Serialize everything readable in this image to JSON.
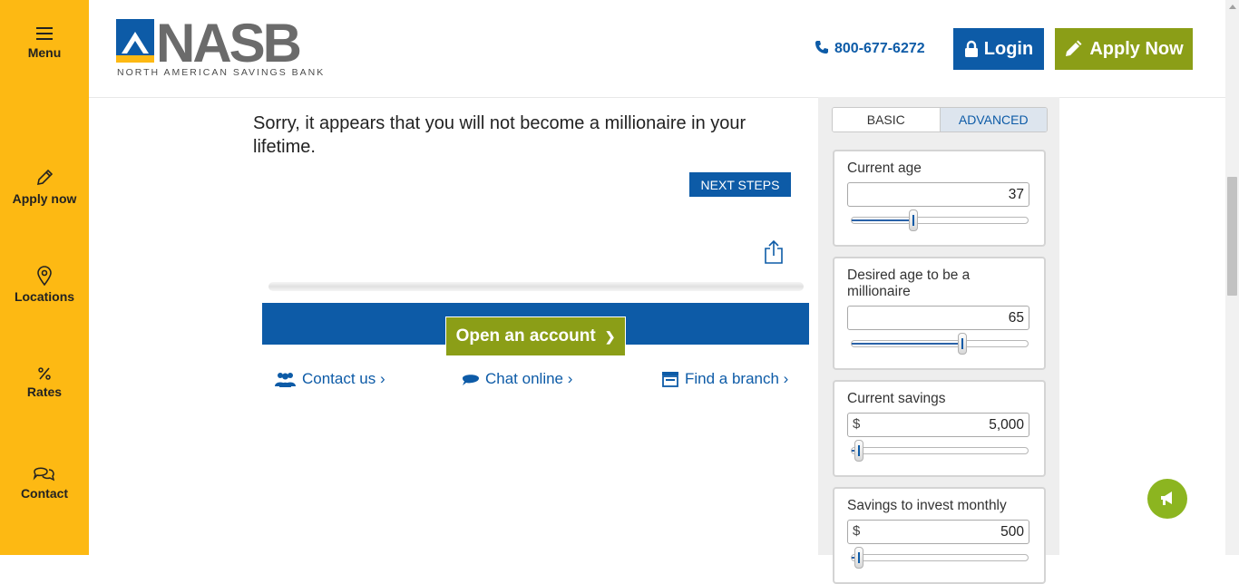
{
  "sidebar": {
    "items": [
      {
        "label": "Menu",
        "icon": "hamburger-icon"
      },
      {
        "label": "Apply now",
        "icon": "pencil-icon"
      },
      {
        "label": "Locations",
        "icon": "map-pin-icon"
      },
      {
        "label": "Rates",
        "icon": "percent-icon"
      },
      {
        "label": "Contact",
        "icon": "chat-bubbles-icon"
      }
    ]
  },
  "header": {
    "logo_text": "NASB",
    "logo_subtitle": "NORTH AMERICAN SAVINGS BANK",
    "phone": "800-677-6272",
    "login_label": "Login",
    "apply_label": "Apply Now"
  },
  "main": {
    "result_message": "Sorry, it appears that you will not become a millionaire in your lifetime.",
    "next_steps_label": "NEXT STEPS",
    "open_account_label": "Open an account",
    "open_account_chevron": "❯",
    "links": {
      "contact": "Contact us ›",
      "chat": "Chat online ›",
      "branch": "Find a branch ›"
    }
  },
  "calculator": {
    "tabs": {
      "basic": "BASIC",
      "advanced": "ADVANCED"
    },
    "fields": [
      {
        "label": "Current age",
        "value": "37",
        "currency": "",
        "slider_fraction": 0.35
      },
      {
        "label": "Desired age to be a millionaire",
        "value": "65",
        "currency": "",
        "slider_fraction": 0.63
      },
      {
        "label": "Current savings",
        "value": "5,000",
        "currency": "$",
        "slider_fraction": 0.04
      },
      {
        "label": "Savings to invest monthly",
        "value": "500",
        "currency": "$",
        "slider_fraction": 0.04
      }
    ]
  },
  "colors": {
    "brand_blue": "#0d5ba7",
    "brand_green": "#8b9e17",
    "sidebar_yellow": "#fdb913",
    "feedback_green": "#8cb520"
  }
}
